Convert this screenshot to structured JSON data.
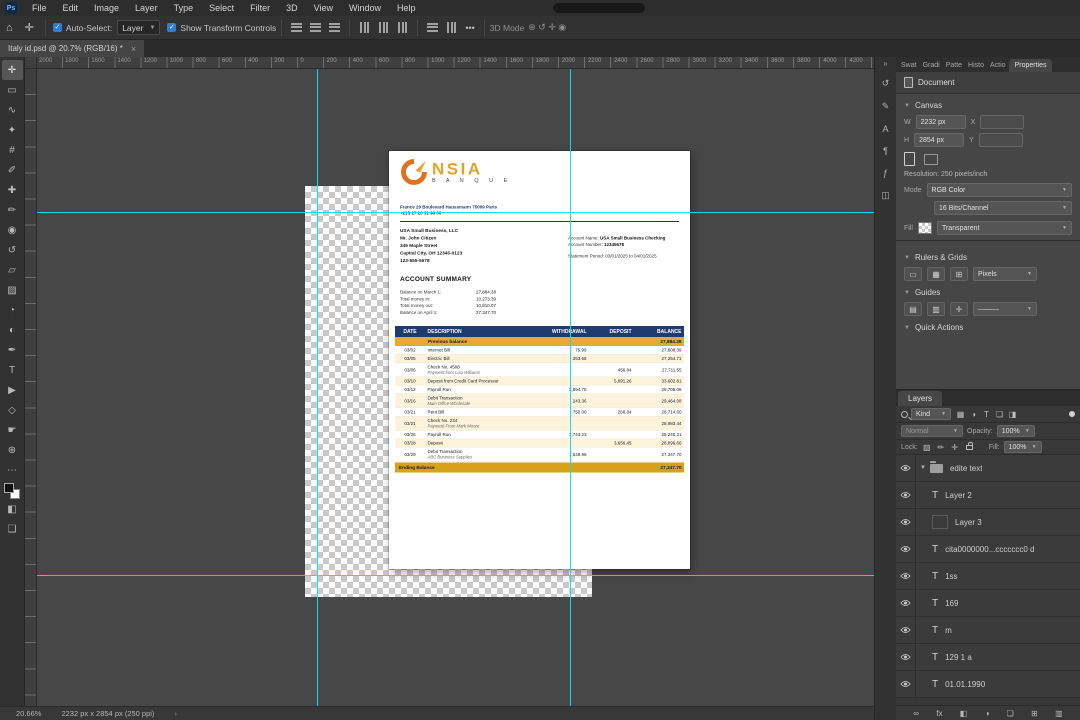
{
  "colors": {
    "accent_blue": "#2f7bd6",
    "guide_cyan": "#00e6e6",
    "statement_navy": "#1e3a6e",
    "statement_gold": "#e5aa2e",
    "logo_gold": "#e2a32c",
    "logo_orange": "#e2711d"
  },
  "app": {
    "ps_badge": "Ps",
    "menu": [
      "File",
      "Edit",
      "Image",
      "Layer",
      "Type",
      "Select",
      "Filter",
      "3D",
      "View",
      "Window",
      "Help"
    ],
    "status_zoom": "20.66%",
    "status_doc": "2232 px x 2854 px (250 ppi)",
    "status_chevron": "›"
  },
  "options_bar": {
    "home_glyph": "⌂",
    "move_glyph": "✛",
    "auto_select_label": "Auto-Select:",
    "auto_select_value": "Layer",
    "transform_label": "Show Transform Controls",
    "more_glyph": "•••",
    "mode_label": "3D Mode",
    "mode_glyphs": "⊕ ↺ ✛ ◉"
  },
  "document_tab": {
    "title": "Italy id.psd @ 20.7% (RGB/16) *",
    "close": "×"
  },
  "ruler_labels": [
    "2000",
    "1800",
    "1600",
    "1400",
    "1200",
    "1000",
    "800",
    "600",
    "400",
    "200",
    "0",
    "200",
    "400",
    "600",
    "800",
    "1000",
    "1200",
    "1400",
    "1600",
    "1800",
    "2000",
    "2200",
    "2400",
    "2600",
    "2800",
    "3000",
    "3200",
    "3400",
    "3600",
    "3800",
    "4000",
    "4200"
  ],
  "toolbar": {
    "tools": [
      {
        "name": "move-tool-icon",
        "glyph": "✛",
        "state": "active"
      },
      {
        "name": "marquee-tool-icon",
        "glyph": "▭",
        "state": ""
      },
      {
        "name": "lasso-tool-icon",
        "glyph": "∿",
        "state": ""
      },
      {
        "name": "magic-wand-tool-icon",
        "glyph": "✦",
        "state": ""
      },
      {
        "name": "crop-tool-icon",
        "glyph": "#",
        "state": ""
      },
      {
        "name": "eyedropper-tool-icon",
        "glyph": "✐",
        "state": ""
      },
      {
        "name": "healing-brush-tool-icon",
        "glyph": "✚",
        "state": ""
      },
      {
        "name": "brush-tool-icon",
        "glyph": "✏",
        "state": ""
      },
      {
        "name": "clone-stamp-tool-icon",
        "glyph": "◉",
        "state": ""
      },
      {
        "name": "history-brush-tool-icon",
        "glyph": "↺",
        "state": ""
      },
      {
        "name": "eraser-tool-icon",
        "glyph": "▱",
        "state": ""
      },
      {
        "name": "gradient-tool-icon",
        "glyph": "▨",
        "state": ""
      },
      {
        "name": "blur-tool-icon",
        "glyph": "◔",
        "state": ""
      },
      {
        "name": "dodge-tool-icon",
        "glyph": "◐",
        "state": ""
      },
      {
        "name": "pen-tool-icon",
        "glyph": "✒",
        "state": ""
      },
      {
        "name": "type-tool-icon",
        "glyph": "T",
        "state": ""
      },
      {
        "name": "path-selection-tool-icon",
        "glyph": "▶",
        "state": ""
      },
      {
        "name": "shape-tool-icon",
        "glyph": "◇",
        "state": ""
      },
      {
        "name": "hand-tool-icon",
        "glyph": "☛",
        "state": ""
      },
      {
        "name": "zoom-tool-icon",
        "glyph": "⊕",
        "state": ""
      },
      {
        "name": "toolbar-more-icon",
        "glyph": "⋯",
        "state": ""
      }
    ],
    "quick_mask_glyph": "◧",
    "screen_mode_glyph": "❏"
  },
  "panel_strip": {
    "collapse_glyph": "»",
    "icons": [
      {
        "name": "history-panel-icon",
        "glyph": "↺"
      },
      {
        "name": "brush-settings-panel-icon",
        "glyph": "✎"
      },
      {
        "name": "character-panel-icon",
        "glyph": "A"
      },
      {
        "name": "paragraph-panel-icon",
        "glyph": "¶"
      },
      {
        "name": "glyphs-panel-icon",
        "glyph": "ƒ"
      },
      {
        "name": "libraries-panel-icon",
        "glyph": "◫"
      }
    ]
  },
  "properties": {
    "tabs": [
      "Swat",
      "Gradi",
      "Patte",
      "Histo",
      "Actio"
    ],
    "active_tab": "Properties",
    "document_label": "Document",
    "canvas_section": "Canvas",
    "w_label": "W",
    "w_value": "2232 px",
    "x_label": "X",
    "h_label": "H",
    "h_value": "2854 px",
    "y_label": "Y",
    "resolution": "Resolution: 250 pixels/inch",
    "mode_label": "Mode",
    "mode_value": "RGB Color",
    "depth_value": "16 Bits/Channel",
    "fill_label": "Fill",
    "fill_value": "Transparent",
    "rulers_grids_section": "Rulers & Grids",
    "units_value": "Pixels",
    "guides_section": "Guides",
    "guide_line_value": "———",
    "quick_actions_section": "Quick Actions"
  },
  "layers_panel": {
    "tab": "Layers",
    "kind_value": "Kind",
    "filter_icons": [
      {
        "name": "filter-pixel-layers-icon",
        "glyph": "▦"
      },
      {
        "name": "filter-adjustment-layers-icon",
        "glyph": "◑"
      },
      {
        "name": "filter-type-layers-icon",
        "glyph": "T"
      },
      {
        "name": "filter-group-layers-icon",
        "glyph": "❏"
      },
      {
        "name": "filter-smart-objects-icon",
        "glyph": "◨"
      }
    ],
    "blend_mode": "Normal",
    "opacity_label": "Opacity:",
    "opacity_value": "100%",
    "lock_label": "Lock:",
    "fill_label": "Fill:",
    "fill_value": "100%",
    "items": [
      {
        "name": "edite text",
        "type": "group",
        "glyph": ""
      },
      {
        "name": "Layer 2",
        "type": "text",
        "glyph": "T"
      },
      {
        "name": "Layer 3",
        "type": "thumb",
        "glyph": ""
      },
      {
        "name": "cita0000000...ccccccc0 d",
        "type": "text",
        "glyph": "T"
      },
      {
        "name": "1ss",
        "type": "text",
        "glyph": "T"
      },
      {
        "name": "169",
        "type": "text",
        "glyph": "T"
      },
      {
        "name": "m",
        "type": "text",
        "glyph": "T"
      },
      {
        "name": "129 1 a",
        "type": "text",
        "glyph": "T"
      },
      {
        "name": "01.01.1990",
        "type": "text",
        "glyph": "T"
      }
    ],
    "bottom_icons": [
      {
        "name": "link-layers-icon",
        "glyph": "∞"
      },
      {
        "name": "layer-effects-icon",
        "glyph": "fx"
      },
      {
        "name": "layer-mask-icon",
        "glyph": "◧"
      },
      {
        "name": "adjustment-layer-icon",
        "glyph": "◑"
      },
      {
        "name": "new-group-icon",
        "glyph": "❏"
      },
      {
        "name": "new-layer-icon",
        "glyph": "⊞"
      },
      {
        "name": "delete-layer-icon",
        "glyph": "▥"
      }
    ]
  },
  "statement": {
    "logo_name": "NSIA",
    "logo_sub": "B A N Q U E",
    "address_line1": "France 29 Boulevard Haussmann 75009 Paris",
    "address_line2": "+225 27 20 31 96 00",
    "customer": [
      "USA Small Business, LLC",
      "Mr. John Citizen",
      "345 Maple Street",
      "Capital City, OH 12345-0123",
      "123-555-5678"
    ],
    "account_name_label": "Account Name:",
    "account_name": "USA Small Business Checking",
    "account_number_label": "Account Number:",
    "account_number": "12345678",
    "period": "Statement Period: 03/01/2025 to 04/01/2025",
    "summary_title": "ACCOUNT SUMMARY",
    "summary": [
      {
        "label": "Balance on March 1:",
        "value": "27,884.38"
      },
      {
        "label": "Total money in:",
        "value": "10,273.39"
      },
      {
        "label": "Total money out:",
        "value": "10,810.07"
      },
      {
        "label": "Balance on April 1:",
        "value": "27,347.70"
      }
    ],
    "table": {
      "headers": [
        "DATE",
        "DESCRIPTION",
        "WITHDRAWAL",
        "DEPOSIT",
        "BALANCE"
      ],
      "previous_balance_label": "Previous balance",
      "previous_balance": "27,884.38",
      "rows": [
        {
          "date": "03/02",
          "desc": "Internet Bill",
          "desc2": "",
          "withdrawal": "75.99",
          "deposit": "",
          "balance": "27,808.39",
          "cls": ""
        },
        {
          "date": "03/05",
          "desc": "Electric Bill",
          "desc2": "",
          "withdrawal": "253.68",
          "deposit": "",
          "balance": "27,254.71",
          "cls": "alt"
        },
        {
          "date": "03/06",
          "desc": "Check No. 4508",
          "desc2": "Payment from Lisa Williams",
          "withdrawal": "",
          "deposit": "456.84",
          "balance": "27,711.55",
          "cls": ""
        },
        {
          "date": "03/10",
          "desc": "Deposit from Credit Card Processor",
          "desc2": "",
          "withdrawal": "",
          "deposit": "5,891.26",
          "balance": "33,602.81",
          "cls": "alt"
        },
        {
          "date": "03/12",
          "desc": "Payroll Run",
          "desc2": "",
          "withdrawal": "3,894.75",
          "deposit": "",
          "balance": "29,708.06",
          "cls": ""
        },
        {
          "date": "03/16",
          "desc": "Debit Transaction",
          "desc2": "Main Office Wholesale",
          "withdrawal": "243.36",
          "deposit": "",
          "balance": "29,464.08",
          "cls": "alt"
        },
        {
          "date": "03/21",
          "desc": "Rent Bill",
          "desc2": "",
          "withdrawal": "750.00",
          "deposit": "268.84",
          "balance": "28,714.60",
          "cls": ""
        },
        {
          "date": "03/21",
          "desc": "Check No. 234",
          "desc2": "Payment From Mark Moore",
          "withdrawal": "",
          "deposit": "",
          "balance": "28,983.44",
          "cls": "alt"
        },
        {
          "date": "03/26",
          "desc": "Payroll Run",
          "desc2": "",
          "withdrawal": "3,743.23",
          "deposit": "",
          "balance": "25,240.21",
          "cls": ""
        },
        {
          "date": "03/28",
          "desc": "Deposit",
          "desc2": "",
          "withdrawal": "",
          "deposit": "3,656.45",
          "balance": "28,896.66",
          "cls": "alt"
        },
        {
          "date": "03/29",
          "desc": "Debit Transaction",
          "desc2": "ABC Business Supplies",
          "withdrawal": "1,548.96",
          "deposit": "",
          "balance": "27,347.70",
          "cls": ""
        }
      ],
      "ending_label": "Ending Balance",
      "ending_balance": "27,347.70"
    }
  }
}
